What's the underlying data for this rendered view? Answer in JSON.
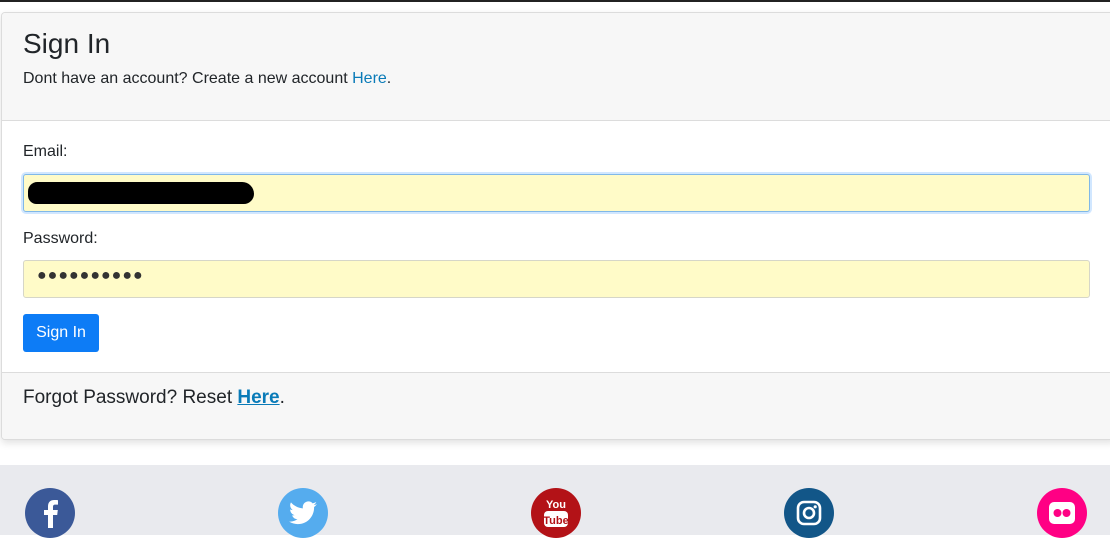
{
  "signin": {
    "title": "Sign In",
    "subtitle_prefix": "Dont have an account? Create a new account ",
    "subtitle_link": "Here",
    "subtitle_suffix": ".",
    "email_label": "Email:",
    "password_label": "Password:",
    "password_mask": "●●●●●●●●●●",
    "button_label": "Sign In",
    "forgot_prefix": "Forgot Password? Reset ",
    "forgot_link": "Here",
    "forgot_suffix": "."
  },
  "social": [
    {
      "name": "facebook",
      "icon": "facebook-icon",
      "color": "#3b5998"
    },
    {
      "name": "twitter",
      "icon": "twitter-icon",
      "color": "#55acee"
    },
    {
      "name": "youtube",
      "icon": "youtube-icon",
      "color": "#b31217",
      "text_top": "You",
      "text_bottom": "Tube"
    },
    {
      "name": "instagram",
      "icon": "instagram-icon",
      "color": "#125688"
    },
    {
      "name": "flickr",
      "icon": "flickr-icon",
      "color": "#ff0084"
    }
  ],
  "colors": {
    "primary_button": "#0d7cf6",
    "link": "#0a7bb8",
    "autofill_bg": "#fffbc8"
  }
}
